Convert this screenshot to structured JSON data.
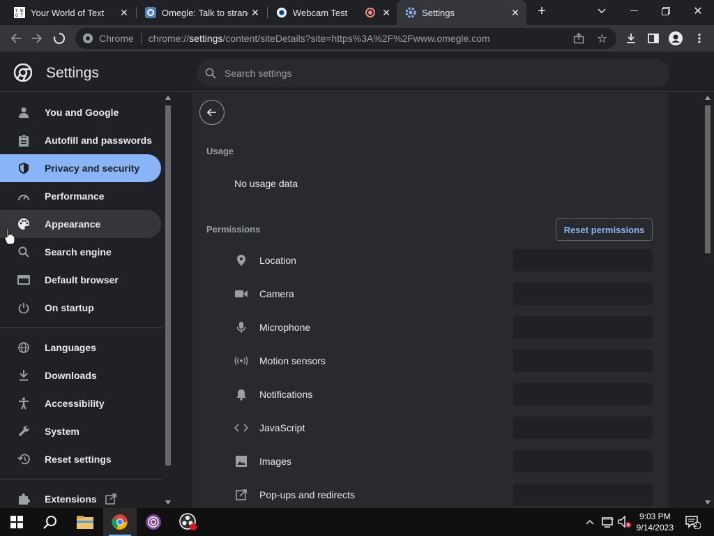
{
  "tabs": [
    {
      "title": "Your World of Text",
      "favicon": "text-favicon",
      "active": false
    },
    {
      "title": "Omegle: Talk to strangers!",
      "favicon": "omegle-favicon",
      "active": false
    },
    {
      "title": "Webcam Test",
      "favicon": "webcam-favicon",
      "recording": true,
      "active": false
    },
    {
      "title": "Settings",
      "favicon": "settings-favicon",
      "active": true
    }
  ],
  "new_tab_icon": "plus-icon",
  "window_controls": {
    "tab_search": "chevron-down-icon",
    "minimize": "minimize-icon",
    "restore": "restore-icon",
    "close": "close-icon"
  },
  "toolbar": {
    "site_label": "Chrome",
    "url_prefix": "chrome://",
    "url_host": "settings",
    "url_path": "/content/siteDetails?site=https%3A%2F%2Fwww.omegle.com"
  },
  "settings": {
    "title": "Settings",
    "search_placeholder": "Search settings"
  },
  "sidebar": {
    "items": [
      {
        "label": "You and Google",
        "icon": "person-icon"
      },
      {
        "label": "Autofill and passwords",
        "icon": "clipboard-icon"
      },
      {
        "label": "Privacy and security",
        "icon": "shield-icon",
        "selected": true
      },
      {
        "label": "Performance",
        "icon": "speedometer-icon"
      },
      {
        "label": "Appearance",
        "icon": "palette-icon",
        "hover": true
      },
      {
        "label": "Search engine",
        "icon": "search-icon"
      },
      {
        "label": "Default browser",
        "icon": "browser-icon"
      },
      {
        "label": "On startup",
        "icon": "power-icon"
      },
      {
        "label": "Languages",
        "icon": "globe-icon"
      },
      {
        "label": "Downloads",
        "icon": "download-icon"
      },
      {
        "label": "Accessibility",
        "icon": "accessibility-icon"
      },
      {
        "label": "System",
        "icon": "wrench-icon"
      },
      {
        "label": "Reset settings",
        "icon": "history-icon"
      },
      {
        "label": "Extensions",
        "icon": "puzzle-icon"
      }
    ]
  },
  "content": {
    "usage_heading": "Usage",
    "usage_text": "No usage data",
    "permissions_heading": "Permissions",
    "reset_button": "Reset permissions",
    "permissions": [
      {
        "label": "Location",
        "icon": "location-pin-icon"
      },
      {
        "label": "Camera",
        "icon": "camera-icon"
      },
      {
        "label": "Microphone",
        "icon": "microphone-icon"
      },
      {
        "label": "Motion sensors",
        "icon": "motion-sensor-icon"
      },
      {
        "label": "Notifications",
        "icon": "bell-icon"
      },
      {
        "label": "JavaScript",
        "icon": "code-icon"
      },
      {
        "label": "Images",
        "icon": "image-icon"
      },
      {
        "label": "Pop-ups and redirects",
        "icon": "popup-icon"
      }
    ]
  },
  "taskbar": {
    "time": "9:03 PM",
    "date": "9/14/2023",
    "notification_count": "2"
  }
}
